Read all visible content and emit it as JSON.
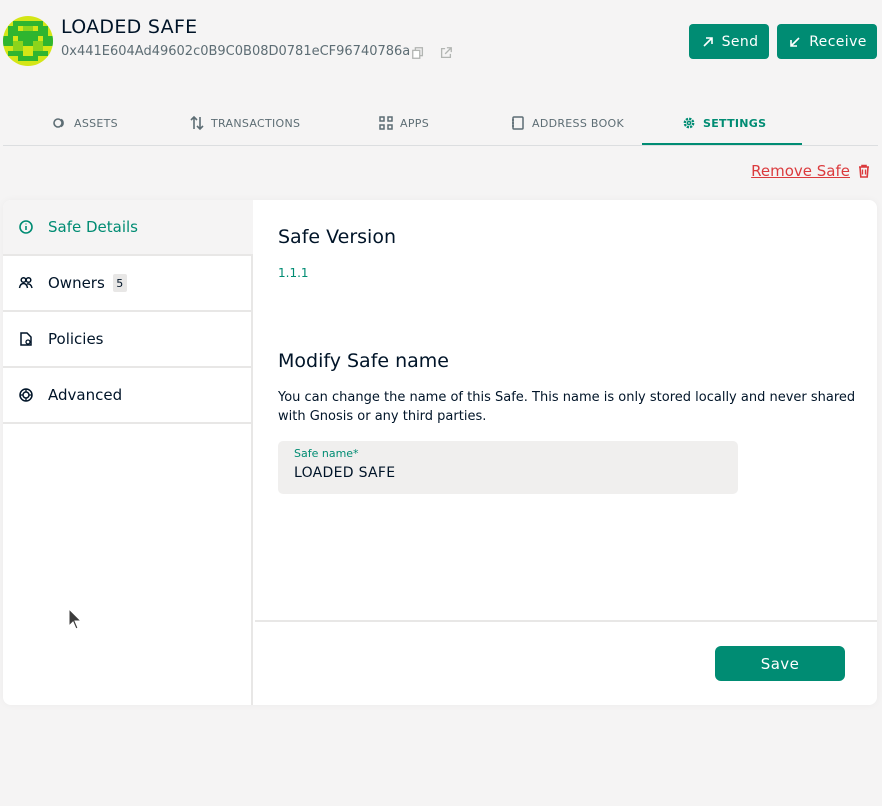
{
  "header": {
    "safe_name": "LOADED SAFE",
    "address": "0x441E604Ad49602c0B9C0B08D0781eCF96740786a",
    "copy_icon": "copy-icon",
    "explorer_icon": "external-link-icon",
    "send_label": "Send",
    "receive_label": "Receive"
  },
  "tabs": [
    {
      "label": "ASSETS",
      "icon": "assets-icon"
    },
    {
      "label": "TRANSACTIONS",
      "icon": "transactions-icon"
    },
    {
      "label": "APPS",
      "icon": "apps-icon"
    },
    {
      "label": "ADDRESS BOOK",
      "icon": "address-book-icon"
    },
    {
      "label": "SETTINGS",
      "icon": "gear-icon",
      "active": true
    }
  ],
  "remove_safe_label": "Remove Safe",
  "sidebar": {
    "items": [
      {
        "label": "Safe Details",
        "icon": "info-icon",
        "active": true
      },
      {
        "label": "Owners",
        "icon": "owners-icon",
        "badge": "5"
      },
      {
        "label": "Policies",
        "icon": "policies-icon"
      },
      {
        "label": "Advanced",
        "icon": "advanced-icon"
      }
    ]
  },
  "details": {
    "version_heading": "Safe Version",
    "version_value": "1.1.1",
    "modify_heading": "Modify Safe name",
    "modify_description": "You can change the name of this Safe. This name is only stored locally and never shared with Gnosis or any third parties.",
    "name_field_label": "Safe name*",
    "name_field_value": "LOADED SAFE",
    "save_label": "Save"
  },
  "colors": {
    "accent": "#008c73",
    "danger": "#db3a3d",
    "background": "#f5f4f4",
    "text": "#001428"
  }
}
